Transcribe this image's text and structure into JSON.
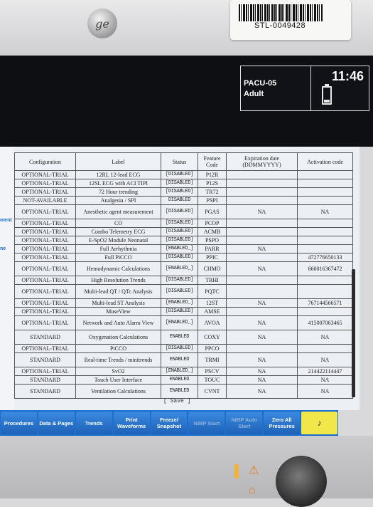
{
  "device": {
    "logo": "ge",
    "asset_tag": "STL-0049428"
  },
  "header": {
    "bed": "PACU-05",
    "patient_type": "Adult",
    "time": "11:46"
  },
  "side_labels": [
    "ment",
    "ne"
  ],
  "columns": [
    "Configuration",
    "Label",
    "Status",
    "Feature Code",
    "Expiration date (DDMMYYYY)",
    "Activation code"
  ],
  "rows": [
    [
      "OPTIONAL-TRIAL",
      "12RL 12-lead ECG",
      "[DISABLED]",
      "P12R",
      "",
      ""
    ],
    [
      "OPTIONAL-TRIAL",
      "12SL ECG with ACI TIPI",
      "[DISABLED]",
      "P12S",
      "",
      ""
    ],
    [
      "OPTIONAL-TRIAL",
      "72 Hour trending",
      "[DISABLED]",
      "TR72",
      "",
      ""
    ],
    [
      "NOT-AVAILABLE",
      "Analgesia / SPI",
      "DISABLED",
      "PSPI",
      "",
      ""
    ],
    [
      "OPTIONAL-TRIAL",
      "Anesthetic agent measurement",
      "[DISABLED]",
      "PGAS",
      "NA",
      "NA"
    ],
    [
      "OPTIONAL-TRIAL",
      "CO",
      "[DISABLED]",
      "PCOP",
      "",
      ""
    ],
    [
      "OPTIONAL-TRIAL",
      "Combo Telemetry ECG",
      "[DISABLED]",
      "ACMB",
      "",
      ""
    ],
    [
      "OPTIONAL-TRIAL",
      "E-SpO2 Module Neonatal",
      "[DISABLED]",
      "PSPO",
      "",
      ""
    ],
    [
      "OPTIONAL-TRIAL",
      "Full Arrhythmia",
      "[ENABLED_]",
      "PARR",
      "NA",
      ""
    ],
    [
      "OPTIONAL-TRIAL",
      "Full PiCCO",
      "[DISABLED]",
      "PPIC",
      "",
      "472776650133"
    ],
    [
      "OPTIONAL-TRIAL",
      "Hemodynamic Calculations",
      "[ENABLED_]",
      "CHMO",
      "NA",
      "660016367472"
    ],
    [
      "OPTIONAL-TRIAL",
      "High Resolution Trends",
      "[DISABLED]",
      "TRHI",
      "",
      ""
    ],
    [
      "OPTIONAL-TRIAL",
      "Multi-lead QT / QTc Analysis",
      "[DISABLED]",
      "PQTC",
      "",
      ""
    ],
    [
      "OPTIONAL-TRIAL",
      "Multi-lead ST Analysis",
      "[ENABLED_]",
      "12ST",
      "NA",
      "767144566571"
    ],
    [
      "OPTIONAL-TRIAL",
      "MuseView",
      "[DISABLED]",
      "AMSE",
      "",
      ""
    ],
    [
      "OPTIONAL-TRIAL",
      "Network and Auto Alarm View",
      "[ENABLED_]",
      "AVOA",
      "NA",
      "415007063465"
    ],
    [
      "STANDARD",
      "Oxygenation Calculations",
      "ENABLED",
      "COXY",
      "NA",
      "NA"
    ],
    [
      "OPTIONAL-TRIAL",
      "PiCCO",
      "[DISABLED]",
      "PPCO",
      "",
      ""
    ],
    [
      "STANDARD",
      "Real-time Trends / minitrends",
      "ENABLED",
      "TRMI",
      "NA",
      "NA"
    ],
    [
      "OPTIONAL-TRIAL",
      "SvO2",
      "[ENABLED_]",
      "PSCV",
      "NA",
      "214422114447"
    ],
    [
      "STANDARD",
      "Touch User Interface",
      "ENABLED",
      "TOUC",
      "NA",
      "NA"
    ],
    [
      "STANDARD",
      "Ventilation Calculations",
      "ENABLED",
      "CVNT",
      "NA",
      "NA"
    ]
  ],
  "save_label": "[ Save ]",
  "toolbar": [
    {
      "label": "Procedures",
      "enabled": true
    },
    {
      "label": "Data & Pages",
      "enabled": true
    },
    {
      "label": "Trends",
      "enabled": true
    },
    {
      "label": "Print Waveforms",
      "enabled": true
    },
    {
      "label": "Freeze/ Snapshot",
      "enabled": true
    },
    {
      "label": "NIBP Start",
      "enabled": false
    },
    {
      "label": "NIBP Auto Start",
      "enabled": false
    },
    {
      "label": "Zero All Pressures",
      "enabled": true
    },
    {
      "label": "",
      "enabled": true,
      "icon": "alarm-bell-icon"
    }
  ]
}
